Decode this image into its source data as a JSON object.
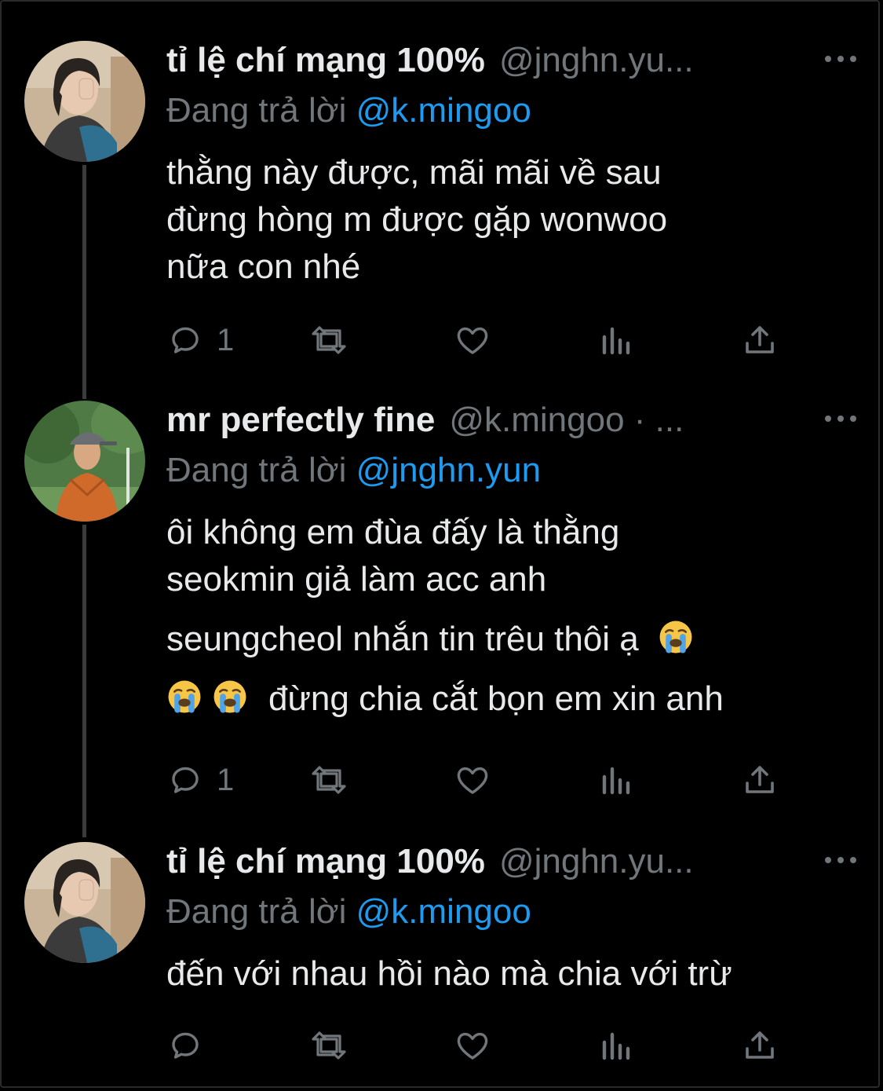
{
  "colors": {
    "background": "#000000",
    "text": "#e7e9ea",
    "muted": "#71767b",
    "mention": "#1d9bf0",
    "thread_line": "#3a3b3d"
  },
  "tweets": [
    {
      "display_name": "tỉ lệ chí mạng 100%",
      "handle": "@jnghn.yun",
      "handle_display": "@jnghn.yu...",
      "reply_prefix": "Đang trả lời",
      "reply_to": "@k.mingoo",
      "avatar": "avatar-photo-person-covering-eye",
      "body_lines": [
        "thằng này được, mãi mãi về sau",
        "đừng hòng m được gặp wonwoo",
        "nữa con nhé"
      ],
      "reply_count": "1",
      "actions": [
        "reply-icon",
        "retweet-icon",
        "like-icon",
        "views-icon",
        "share-icon"
      ]
    },
    {
      "display_name": "mr perfectly fine",
      "handle": "@k.mingoo",
      "handle_display": "@k.mingoo · ...",
      "reply_prefix": "Đang trả lời",
      "reply_to": "@jnghn.yun",
      "avatar": "avatar-photo-man-orange-shirt-cap",
      "body_lines": [
        "ôi không em đùa đấy là thằng",
        "seokmin giả làm acc anh",
        "seungcheol nhắn tin trêu thôi ạ",
        "đừng chia cắt bọn em xin anh"
      ],
      "emoji": "loudly-crying-face-emoji",
      "reply_count": "1",
      "actions": [
        "reply-icon",
        "retweet-icon",
        "like-icon",
        "views-icon",
        "share-icon"
      ]
    },
    {
      "display_name": "tỉ lệ chí mạng 100%",
      "handle": "@jnghn.yun",
      "handle_display": "@jnghn.yu...",
      "reply_prefix": "Đang trả lời",
      "reply_to": "@k.mingoo",
      "avatar": "avatar-photo-person-covering-eye",
      "body_lines": [
        "đến với nhau hồi nào mà chia với trừ"
      ],
      "reply_count": "",
      "actions": [
        "reply-icon",
        "retweet-icon",
        "like-icon",
        "views-icon",
        "share-icon"
      ]
    }
  ]
}
